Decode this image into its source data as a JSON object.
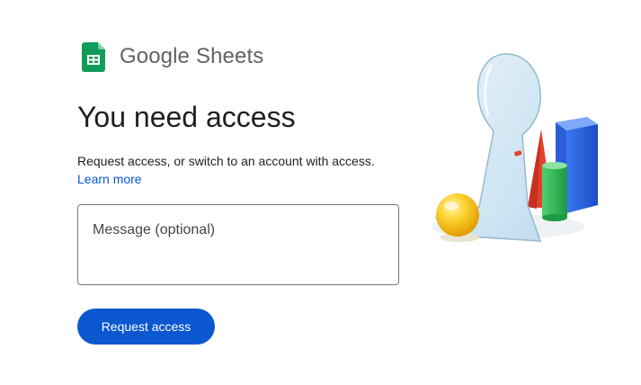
{
  "brand": {
    "word_google": "Google",
    "word_product": "Sheets",
    "icon": "google-sheets-icon",
    "icon_color": "#0f9d58"
  },
  "main": {
    "title": "You need access",
    "description": "Request access, or switch to an account with access.",
    "learn_more_label": "Learn more",
    "message_placeholder": "Message (optional)",
    "message_value": "",
    "request_button_label": "Request access"
  },
  "illustration": {
    "icon": "keyhole-shapes-illustration"
  },
  "colors": {
    "primary": "#0b57d0",
    "text": "#1f1f1f",
    "muted": "#5f6368",
    "border": "#747775"
  }
}
